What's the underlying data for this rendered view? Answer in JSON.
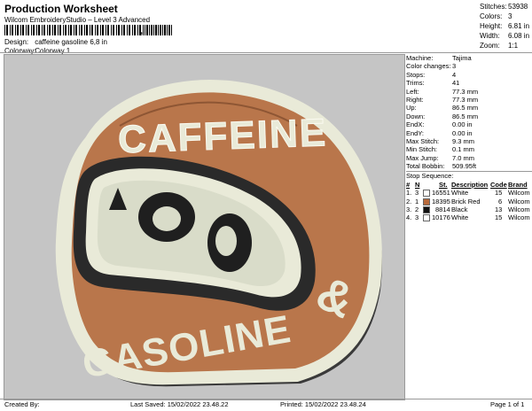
{
  "header": {
    "title": "Production Worksheet",
    "subtitle": "Wilcom EmbroideryStudio – Level 3 Advanced",
    "barcode_mark": ","
  },
  "meta": {
    "design_label": "Design:",
    "design_value": "caffeine gasoline 6,8 in",
    "colorway_label": "Colorway:",
    "colorway_value": "Colorway 1"
  },
  "summary": [
    {
      "label": "Stitches:",
      "value": "53938"
    },
    {
      "label": "Colors:",
      "value": "3"
    },
    {
      "label": "Height:",
      "value": "6.81 in"
    },
    {
      "label": "Width:",
      "value": "6.08 in"
    },
    {
      "label": "Zoom:",
      "value": "1:1"
    }
  ],
  "details": [
    {
      "label": "Machine:",
      "value": "Tajima"
    },
    {
      "label": "Color changes:",
      "value": "3"
    },
    {
      "label": "Stops:",
      "value": "4"
    },
    {
      "label": "Trims:",
      "value": "41"
    },
    {
      "label": "Left:",
      "value": "77.3 mm"
    },
    {
      "label": "Right:",
      "value": "77.3 mm"
    },
    {
      "label": "Up:",
      "value": "86.5 mm"
    },
    {
      "label": "Down:",
      "value": "86.5 mm"
    },
    {
      "label": "EndX:",
      "value": "0.00 in"
    },
    {
      "label": "EndY:",
      "value": "0.00 in"
    },
    {
      "label": "Max Stitch:",
      "value": "9.3 mm"
    },
    {
      "label": "Min Stitch:",
      "value": "0.1 mm"
    },
    {
      "label": "Max Jump:",
      "value": "7.0 mm"
    },
    {
      "label": "Total Bobbin:",
      "value": "509.95ft"
    }
  ],
  "stop_sequence": {
    "title": "Stop Sequence:",
    "headers": {
      "num": "#",
      "n": "N",
      "st": "St.",
      "desc": "Description",
      "code": "Code",
      "brand": "Brand"
    },
    "rows": [
      {
        "num": "1.",
        "n": "3",
        "st": "16551",
        "desc": "White",
        "code": "15",
        "brand": "Wilcom",
        "color": "#ffffff"
      },
      {
        "num": "2.",
        "n": "1",
        "st": "18395",
        "desc": "Brick Red",
        "code": "6",
        "brand": "Wilcom",
        "color": "#b86a3b"
      },
      {
        "num": "3.",
        "n": "2",
        "st": "8814",
        "desc": "Black",
        "code": "13",
        "brand": "Wilcom",
        "color": "#111111"
      },
      {
        "num": "4.",
        "n": "3",
        "st": "10176",
        "desc": "White",
        "code": "15",
        "brand": "Wilcom",
        "color": "#ffffff"
      }
    ]
  },
  "artwork": {
    "top_text": "CAFFEINE",
    "amp": "&",
    "bottom_text": "GASOLINE",
    "helmet_color": "#b9764b",
    "outline_color": "#e9ead8"
  },
  "footer": {
    "created_by": "Created By:",
    "last_saved": "Last Saved: 15/02/2022 23.48.22",
    "printed": "Printed: 15/02/2022 23.48.24",
    "page": "Page 1 of 1"
  }
}
